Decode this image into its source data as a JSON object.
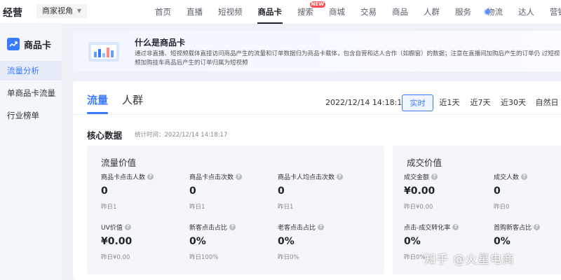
{
  "app": {
    "title": "经营",
    "view_select": "商家视角"
  },
  "nav": {
    "items": [
      "首页",
      "直播",
      "短视频",
      "商品卡",
      "搜索",
      "商城",
      "交易",
      "商品",
      "人群",
      "服务",
      "物流",
      "达人",
      "营销"
    ],
    "active": "商品卡",
    "new_badge": "NEW"
  },
  "sidebar": {
    "title": "商品卡",
    "items": [
      {
        "label": "流量分析",
        "active": true
      },
      {
        "label": "单商品卡流量",
        "active": false
      },
      {
        "label": "行业榜单",
        "active": false
      }
    ]
  },
  "banner": {
    "title": "什么是商品卡",
    "text": "通过非直播、短视频载体直接访问商品产生的流量和订单数据归为商品卡载体，包含自营和达人合作（如橱窗）的数据；注意在直播间加购后产生的订单仍 过短视频加购挂车商品后产生的订单归属为短视频"
  },
  "tabs": [
    "流量",
    "人群"
  ],
  "time": {
    "stamp": "2022/12/14 14:18:17",
    "ranges": [
      "实时",
      "近1天",
      "近7天",
      "近30天",
      "自然日"
    ],
    "active_range": "实时"
  },
  "core": {
    "title": "核心数据",
    "stat_time": "统计时间：2022/12/14 14:18:17"
  },
  "traffic": {
    "title": "流量价值",
    "metrics": [
      {
        "label": "商品卡点击人数",
        "value": "0",
        "sub": "昨日1"
      },
      {
        "label": "商品卡点击次数",
        "value": "0",
        "sub": "昨日1"
      },
      {
        "label": "商品卡人均点击次数",
        "value": "0",
        "sub": "昨日1"
      },
      {
        "label": "UV价值",
        "value": "¥0.00",
        "sub": "昨日¥0.00"
      },
      {
        "label": "新客点击占比",
        "value": "0%",
        "sub": "昨日100%"
      },
      {
        "label": "老客点击占比",
        "value": "0%",
        "sub": "昨日0%"
      }
    ]
  },
  "deal": {
    "title": "成交价值",
    "metrics": [
      {
        "label": "成交金额",
        "value": "¥0.00",
        "sub": "昨日¥0.00"
      },
      {
        "label": "成交人数",
        "value": "0",
        "sub": "昨日0"
      },
      {
        "label": "点击-成交转化率",
        "value": "0%",
        "sub": "昨日0%"
      },
      {
        "label": "首购新客占比",
        "value": "0%",
        "sub": ""
      }
    ]
  },
  "watermark": "知乎 @火星电商",
  "colors": {
    "accent": "#3a7afe",
    "badge": "#ff4d4f"
  }
}
